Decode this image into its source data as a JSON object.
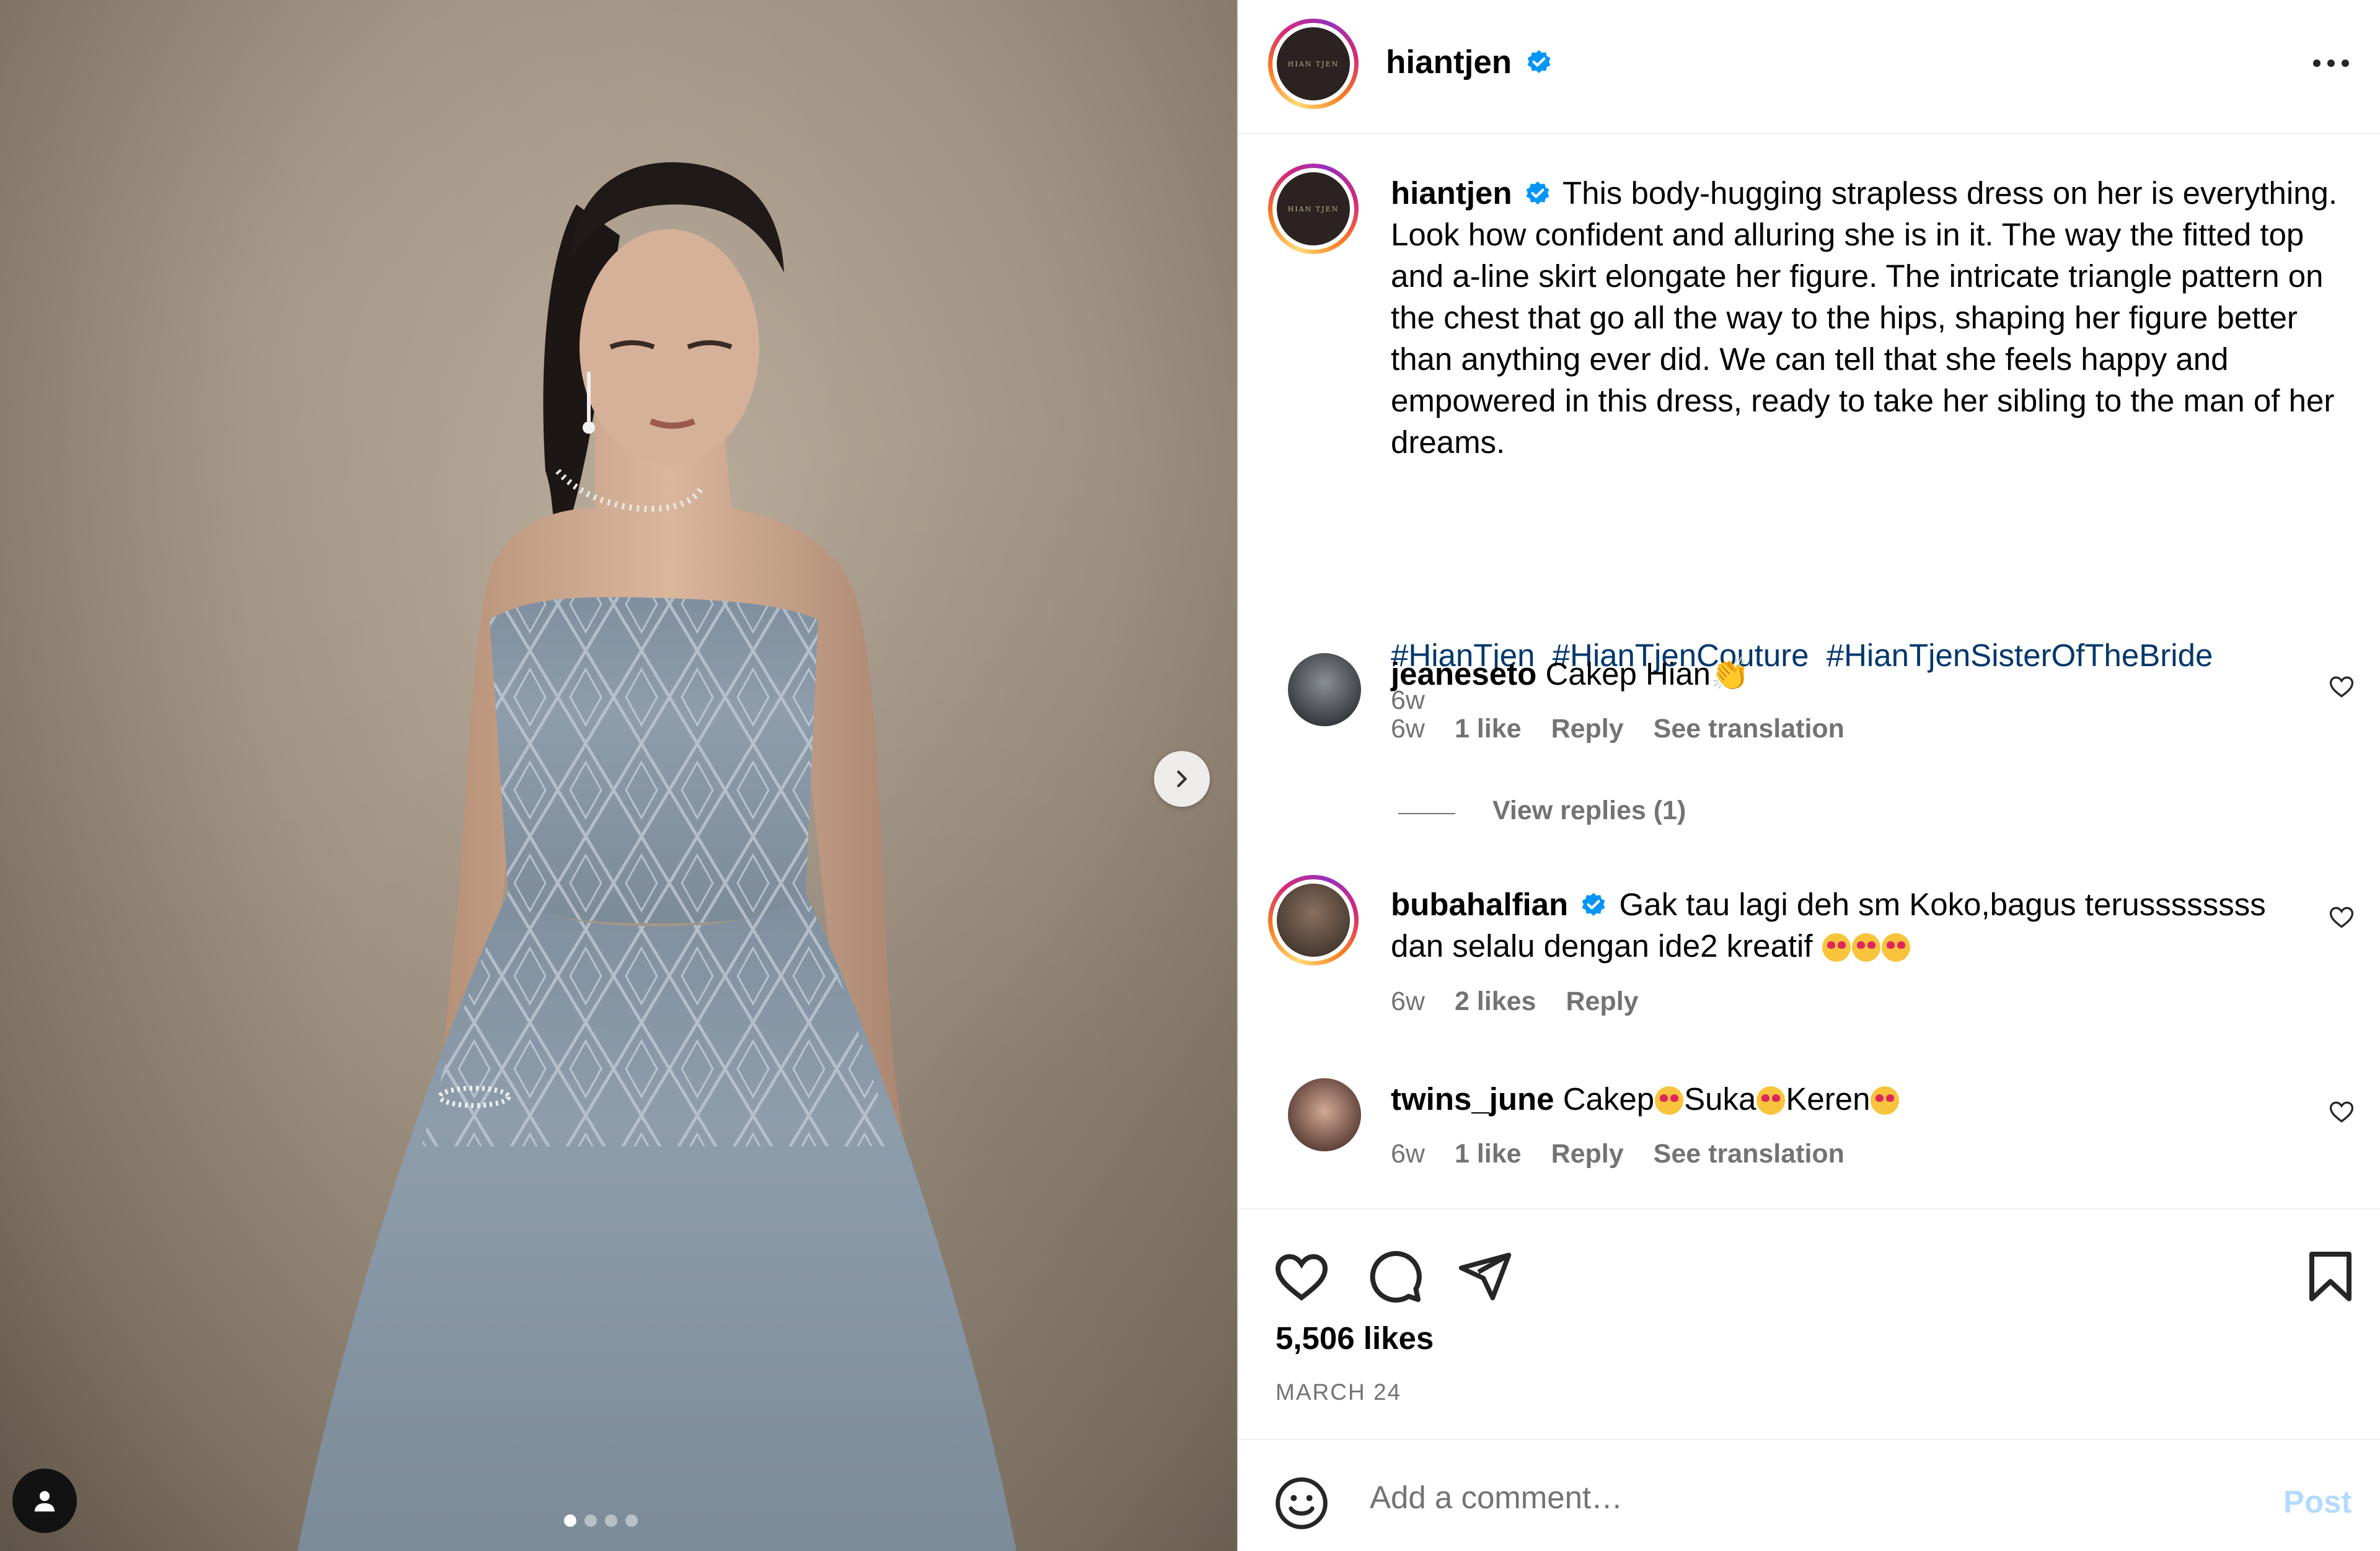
{
  "post": {
    "username": "hiantjen",
    "avatar_text": "HIAN TJEN",
    "more_label": "•••",
    "caption": "This body-hugging strapless dress on her is everything. Look how confident and alluring she is in it. The way the fitted top and a-line skirt elongate her figure. The intricate triangle pattern on the chest that go all the way to the hips, shaping her figure better than anything ever did. We can tell that she feels happy and empowered in this dress, ready to take her sibling to the man of her dreams.",
    "hashtags": [
      "#HianTjen",
      "#HianTjenCouture",
      "#HianTjenSisterOfTheBride"
    ],
    "caption_age": "6w",
    "carousel": {
      "total": 4,
      "active": 1
    }
  },
  "comments": [
    {
      "username": "jeaneseto",
      "verified": false,
      "text": "Cakep Hian👏",
      "age": "6w",
      "likes": "1 like",
      "reply": "Reply",
      "translate": "See translation",
      "view_replies": "View replies (1)"
    },
    {
      "username": "bubahalfian",
      "verified": true,
      "text": "Gak tau lagi deh sm Koko,bagus terussssssss dan selalu dengan ide2 kreatif",
      "age": "6w",
      "likes": "2 likes",
      "reply": "Reply"
    },
    {
      "username": "twins_june",
      "verified": false,
      "text_parts": [
        "Cakep",
        "Suka",
        "Keren"
      ],
      "age": "6w",
      "likes": "1 like",
      "reply": "Reply",
      "translate": "See translation"
    }
  ],
  "footer": {
    "likes": "5,506 likes",
    "date": "MARCH 24",
    "comment_placeholder": "Add a comment…",
    "post_label": "Post"
  },
  "icons": [
    "next-arrow-icon",
    "user-tag-icon",
    "more-icon",
    "verified-icon",
    "heart-icon",
    "comment-icon",
    "share-icon",
    "bookmark-icon",
    "emoji-icon"
  ],
  "colors": {
    "verified": "#0095f6",
    "hashtag": "#00376b",
    "meta": "#737373",
    "post_disabled": "#b3dbff"
  }
}
